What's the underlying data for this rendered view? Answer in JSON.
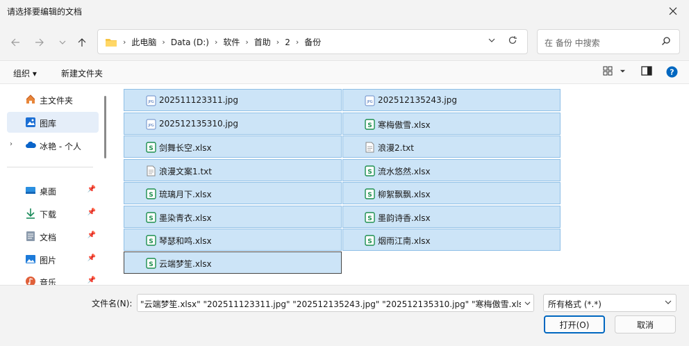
{
  "window": {
    "title": "请选择要编辑的文档"
  },
  "address": {
    "crumbs": [
      "此电脑",
      "Data (D:)",
      "软件",
      "首助",
      "2",
      "备份"
    ]
  },
  "search": {
    "placeholder": "在 备份 中搜索"
  },
  "toolbar": {
    "organize": "组织 ▾",
    "new_folder": "新建文件夹"
  },
  "sidebar": {
    "items": [
      {
        "label": "主文件夹",
        "icon": "home-icon"
      },
      {
        "label": "图库",
        "icon": "gallery-icon"
      },
      {
        "label": "冰艳 - 个人",
        "icon": "onedrive-icon"
      },
      {
        "label": "桌面",
        "icon": "desktop-icon"
      },
      {
        "label": "下载",
        "icon": "download-icon"
      },
      {
        "label": "文档",
        "icon": "document-icon"
      },
      {
        "label": "图片",
        "icon": "pictures-icon"
      },
      {
        "label": "音乐",
        "icon": "music-icon"
      }
    ]
  },
  "files": [
    {
      "name": "202511123311.jpg",
      "type": "jpg"
    },
    {
      "name": "202512135243.jpg",
      "type": "jpg"
    },
    {
      "name": "202512135310.jpg",
      "type": "jpg"
    },
    {
      "name": "寒梅傲雪.xlsx",
      "type": "xlsx"
    },
    {
      "name": "剑舞长空.xlsx",
      "type": "xlsx"
    },
    {
      "name": "浪漫2.txt",
      "type": "txt"
    },
    {
      "name": "浪漫文案1.txt",
      "type": "txt"
    },
    {
      "name": "流水悠然.xlsx",
      "type": "xlsx"
    },
    {
      "name": "琉璃月下.xlsx",
      "type": "xlsx"
    },
    {
      "name": "柳絮飘飘.xlsx",
      "type": "xlsx"
    },
    {
      "name": "墨染青衣.xlsx",
      "type": "xlsx"
    },
    {
      "name": "墨韵诗香.xlsx",
      "type": "xlsx"
    },
    {
      "name": "琴瑟和鸣.xlsx",
      "type": "xlsx"
    },
    {
      "name": "烟雨江南.xlsx",
      "type": "xlsx"
    },
    {
      "name": "云端梦笙.xlsx",
      "type": "xlsx"
    }
  ],
  "footer": {
    "filename_label": "文件名(N):",
    "filename_value": "\"云端梦笙.xlsx\" \"202511123311.jpg\" \"202512135243.jpg\" \"202512135310.jpg\" \"寒梅傲雪.xlsx\" \"剑",
    "filetype": "所有格式 (*.*)",
    "open": "打开(O)",
    "cancel": "取消"
  },
  "colors": {
    "selection": "#cce4f7",
    "accent": "#0067c0",
    "xlsx": "#1d8f4e"
  }
}
